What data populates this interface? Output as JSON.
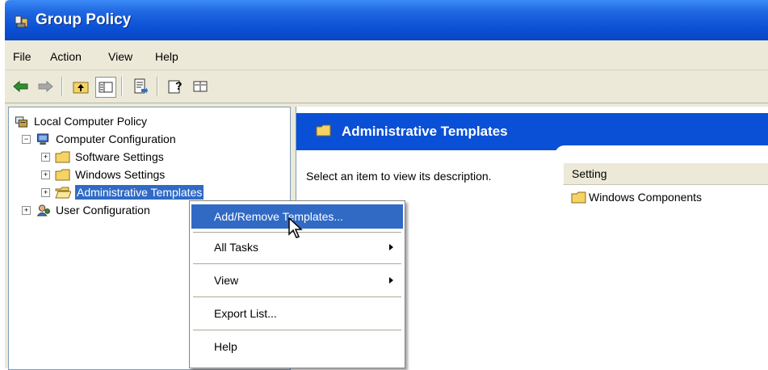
{
  "window": {
    "title": "Group Policy",
    "title_icon": "group-policy-icon"
  },
  "menubar": {
    "items": [
      "File",
      "Action",
      "View",
      "Help"
    ]
  },
  "toolbar": {
    "buttons": [
      "back-icon",
      "forward-icon",
      "up-folder-icon",
      "show-hide-tree-icon",
      "export-list-icon",
      "help-icon",
      "console-tree-icon"
    ]
  },
  "tree": {
    "root": "Local Computer Policy",
    "computer_configuration": "Computer Configuration",
    "software_settings": "Software Settings",
    "windows_settings": "Windows Settings",
    "administrative_templates": "Administrative Templates",
    "user_configuration": "User Configuration"
  },
  "right_pane": {
    "header": "Administrative Templates",
    "description": "Select an item to view its description.",
    "column_header": "Setting",
    "items": [
      "Windows Components"
    ]
  },
  "context_menu": {
    "items": [
      {
        "label": "Add/Remove Templates...",
        "highlighted": true
      },
      {
        "label": "All Tasks",
        "submenu": true
      },
      {
        "label": "View",
        "submenu": true
      },
      {
        "label": "Export List..."
      },
      {
        "label": "Help"
      }
    ]
  },
  "colors": {
    "title_blue": "#0a50d6",
    "selection": "#316ac5",
    "folder": "#f5d364"
  }
}
